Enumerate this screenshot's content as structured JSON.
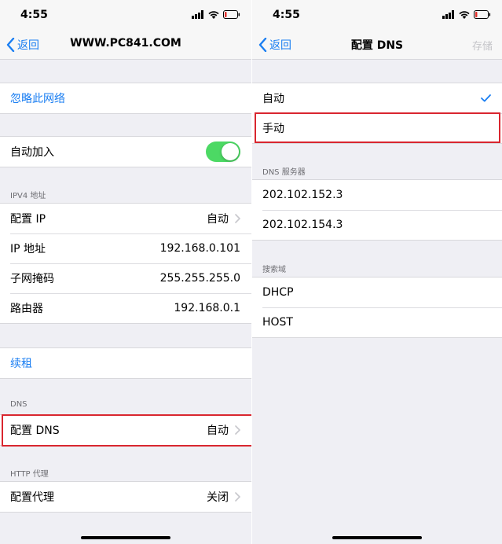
{
  "left": {
    "status": {
      "time": "4:55"
    },
    "nav": {
      "back_label": "返回",
      "title": "WWW.PC841.COM"
    },
    "forget_network": "忽略此网络",
    "auto_join": {
      "label": "自动加入",
      "on": true
    },
    "ipv4_header": "IPV4 地址",
    "ipv4_rows": [
      {
        "label": "配置 IP",
        "value": "自动"
      },
      {
        "label": "IP 地址",
        "value": "192.168.0.101"
      },
      {
        "label": "子网掩码",
        "value": "255.255.255.0"
      },
      {
        "label": "路由器",
        "value": "192.168.0.1"
      }
    ],
    "renew_lease": "续租",
    "dns_header": "DNS",
    "configure_dns": {
      "label": "配置 DNS",
      "value": "自动"
    },
    "http_proxy_header": "HTTP 代理",
    "configure_proxy": {
      "label": "配置代理",
      "value": "关闭"
    }
  },
  "right": {
    "status": {
      "time": "4:55"
    },
    "nav": {
      "back_label": "返回",
      "title": "配置 DNS",
      "save_label": "存储"
    },
    "mode_options": [
      {
        "label": "自动",
        "selected": true
      },
      {
        "label": "手动",
        "selected": false
      }
    ],
    "dns_servers_header": "DNS 服务器",
    "dns_servers": [
      "202.102.152.3",
      "202.102.154.3"
    ],
    "search_domains_header": "搜索域",
    "search_domains": [
      "DHCP",
      "HOST"
    ]
  },
  "colors": {
    "accent": "#1a7ef2",
    "toggle_on": "#4cd964",
    "highlight": "#d9262f"
  },
  "icons": [
    "signal-icon",
    "wifi-icon",
    "battery-icon",
    "back-chevron-icon",
    "chevron-right-icon",
    "checkmark-icon"
  ]
}
